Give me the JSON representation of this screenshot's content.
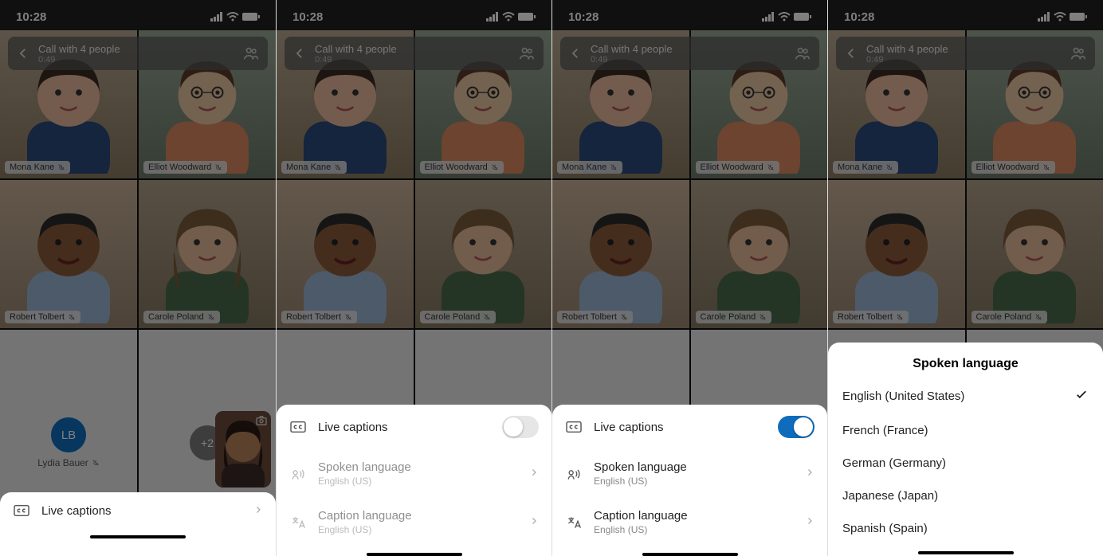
{
  "status": {
    "time": "10:28"
  },
  "header": {
    "title": "Call with 4 people",
    "duration": "0:49"
  },
  "participants": [
    {
      "name": "Mona Kane"
    },
    {
      "name": "Elliot Woodward"
    },
    {
      "name": "Robert Tolbert"
    },
    {
      "name": "Carole Poland"
    }
  ],
  "bottom_tile": {
    "initials": "LB",
    "name": "Lydia Bauer",
    "more": "+2"
  },
  "sheets": {
    "single": {
      "label": "Live captions"
    },
    "settings": {
      "live_captions": "Live captions",
      "spoken": {
        "label": "Spoken language",
        "value": "English (US)"
      },
      "caption": {
        "label": "Caption language",
        "value": "English (US)"
      }
    },
    "language_picker": {
      "title": "Spoken language",
      "options": [
        {
          "label": "English (United States)",
          "selected": true
        },
        {
          "label": "French (France)",
          "selected": false
        },
        {
          "label": "German (Germany)",
          "selected": false
        },
        {
          "label": "Japanese (Japan)",
          "selected": false
        },
        {
          "label": "Spanish (Spain)",
          "selected": false
        }
      ]
    }
  }
}
